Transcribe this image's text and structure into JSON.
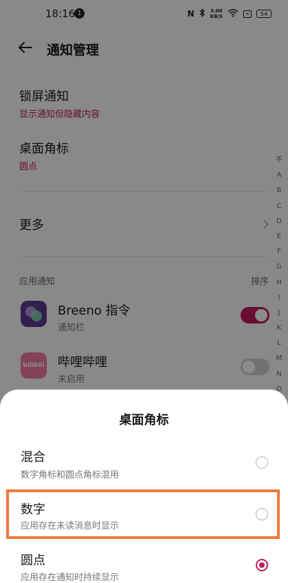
{
  "status_bar": {
    "time": "18:16",
    "notification_count": "1",
    "net_speed_top": "3.00",
    "net_speed_unit": "KB/S",
    "battery": "54"
  },
  "header": {
    "title": "通知管理"
  },
  "settings": {
    "lockscreen_title": "锁屏通知",
    "lockscreen_value": "显示通知但隐藏内容",
    "badge_title": "桌面角标",
    "badge_value": "圆点",
    "more": "更多"
  },
  "app_section": {
    "label": "应用通知",
    "sort": "排序"
  },
  "apps": [
    {
      "name": "Breeno 指令",
      "status": "通知栏",
      "enabled": true
    },
    {
      "name": "哔哩哔哩",
      "status": "未启用",
      "enabled": false,
      "icon_text": "bilibili"
    }
  ],
  "alpha_index": [
    "不",
    "A",
    "B",
    "C",
    "D",
    "E",
    "F",
    "G",
    "H",
    "I",
    "J",
    "K",
    "L",
    "M",
    "N",
    "O"
  ],
  "sheet": {
    "title": "桌面角标",
    "options": [
      {
        "title": "混合",
        "desc": "数字角标和圆点角标混用",
        "selected": false
      },
      {
        "title": "数字",
        "desc": "应用存在未读消息时显示",
        "selected": false
      },
      {
        "title": "圆点",
        "desc": "应用存在通知时持续显示",
        "selected": true
      }
    ]
  },
  "colors": {
    "accent": "#c2185b",
    "highlight": "#f07a3f"
  }
}
